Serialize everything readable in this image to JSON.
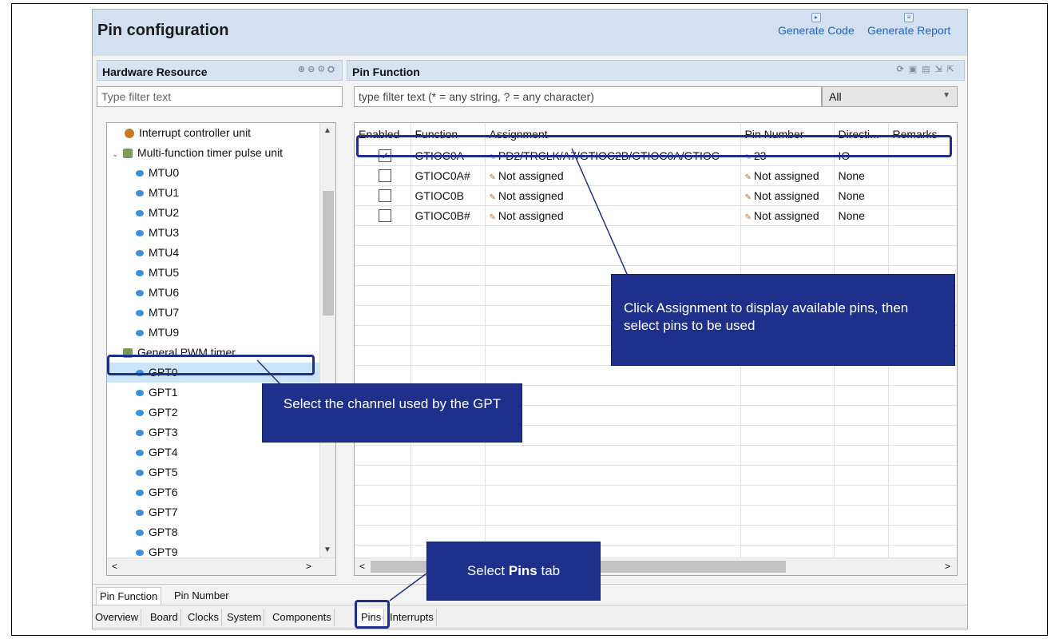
{
  "window": {
    "title": "Pin configuration",
    "generate_code": "Generate Code",
    "generate_report": "Generate Report"
  },
  "hardware_resource": {
    "title": "Hardware Resource",
    "filter_placeholder": "Type filter text",
    "items": [
      {
        "label": "Interrupt controller unit",
        "level": 1,
        "icon": "interrupt-icon"
      },
      {
        "label": "Multi-function timer pulse unit",
        "level": 0,
        "icon": "group-icon"
      },
      {
        "label": "MTU0",
        "level": 2,
        "icon": "channel-icon"
      },
      {
        "label": "MTU1",
        "level": 2,
        "icon": "channel-icon"
      },
      {
        "label": "MTU2",
        "level": 2,
        "icon": "channel-icon"
      },
      {
        "label": "MTU3",
        "level": 2,
        "icon": "channel-icon"
      },
      {
        "label": "MTU4",
        "level": 2,
        "icon": "channel-icon"
      },
      {
        "label": "MTU5",
        "level": 2,
        "icon": "channel-icon"
      },
      {
        "label": "MTU6",
        "level": 2,
        "icon": "channel-icon"
      },
      {
        "label": "MTU7",
        "level": 2,
        "icon": "channel-icon"
      },
      {
        "label": "MTU9",
        "level": 2,
        "icon": "channel-icon"
      },
      {
        "label": "General PWM timer",
        "level": 0,
        "icon": "group-icon"
      },
      {
        "label": "GPT0",
        "level": 2,
        "icon": "channel-icon"
      },
      {
        "label": "GPT1",
        "level": 2,
        "icon": "channel-icon"
      },
      {
        "label": "GPT2",
        "level": 2,
        "icon": "channel-icon"
      },
      {
        "label": "GPT3",
        "level": 2,
        "icon": "channel-icon"
      },
      {
        "label": "GPT4",
        "level": 2,
        "icon": "channel-icon"
      },
      {
        "label": "GPT5",
        "level": 2,
        "icon": "channel-icon"
      },
      {
        "label": "GPT6",
        "level": 2,
        "icon": "channel-icon"
      },
      {
        "label": "GPT7",
        "level": 2,
        "icon": "channel-icon"
      },
      {
        "label": "GPT8",
        "level": 2,
        "icon": "channel-icon"
      },
      {
        "label": "GPT9",
        "level": 2,
        "icon": "channel-icon"
      }
    ],
    "selected": "GPT0"
  },
  "pin_function": {
    "title": "Pin Function",
    "filter_placeholder": "type filter text (* = any string, ? = any character)",
    "filter_combo": "All",
    "columns": [
      "Enabled",
      "Function",
      "Assignment",
      "Pin Number",
      "Directi...",
      "Remarks"
    ],
    "rows": [
      {
        "enabled": true,
        "function": "GTIOC0A",
        "assignment": "PD2/TRCLK/A7/GTIOC2B/GTIOC0A/GTIOC",
        "pin_number": "23",
        "direction": "IO",
        "remarks": ""
      },
      {
        "enabled": false,
        "function": "GTIOC0A#",
        "assignment": "Not assigned",
        "pin_number": "Not assigned",
        "direction": "None",
        "remarks": ""
      },
      {
        "enabled": false,
        "function": "GTIOC0B",
        "assignment": "Not assigned",
        "pin_number": "Not assigned",
        "direction": "None",
        "remarks": ""
      },
      {
        "enabled": false,
        "function": "GTIOC0B#",
        "assignment": "Not assigned",
        "pin_number": "Not assigned",
        "direction": "None",
        "remarks": ""
      }
    ]
  },
  "sub_tabs": [
    "Pin Function",
    "Pin Number"
  ],
  "main_tabs": [
    "Overview",
    "Board",
    "Clocks",
    "System",
    "Components",
    "Pins",
    "Interrupts"
  ],
  "callouts": {
    "assignment": "Click Assignment to display available pins, then select pins to be used",
    "channel": "Select the channel used by the GPT",
    "pins_tab_prefix": "Select ",
    "pins_tab_bold": "Pins",
    "pins_tab_suffix": " tab"
  }
}
